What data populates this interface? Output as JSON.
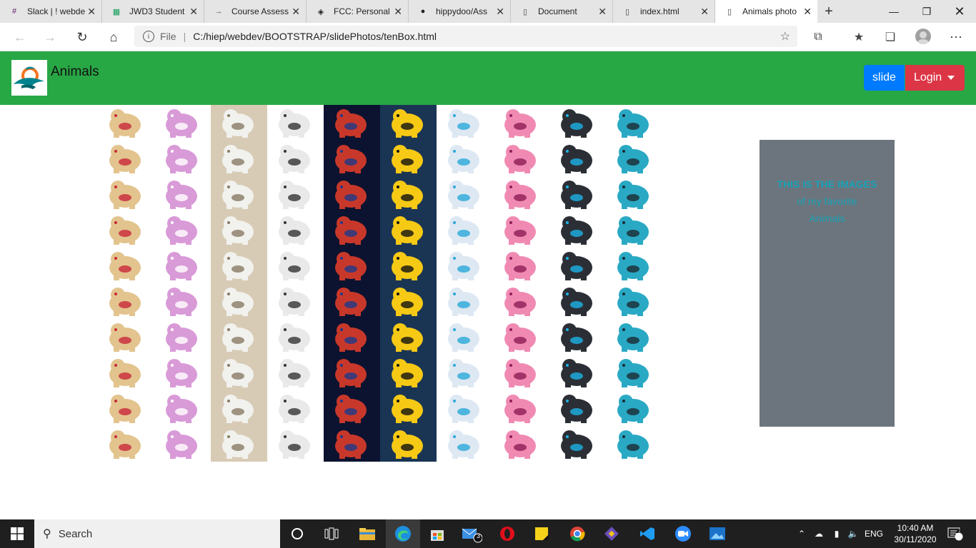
{
  "browser": {
    "tabs": [
      {
        "title": "Slack | ! webde",
        "icon": "slack-icon"
      },
      {
        "title": "JWD3 Student",
        "icon": "sheets-icon"
      },
      {
        "title": "Course Assess",
        "icon": "arrow-icon"
      },
      {
        "title": "FCC: Personal",
        "icon": "codepen-icon"
      },
      {
        "title": "hippydoo/Ass",
        "icon": "github-icon"
      },
      {
        "title": "Document",
        "icon": "page-icon"
      },
      {
        "title": "index.html",
        "icon": "page-icon"
      },
      {
        "title": "Animals photo",
        "icon": "page-icon",
        "active": true
      }
    ],
    "address": {
      "prefix": "File",
      "url": "C:/hiep/webdev/BOOTSTRAP/slidePhotos/tenBox.html"
    }
  },
  "page": {
    "brand": "Animals",
    "buttons": {
      "slide": "slide",
      "login": "Login"
    },
    "info": {
      "line1": "THIS IS THE IMAGES",
      "line2": "of my favorite",
      "line3": "Animals"
    },
    "colors": {
      "navbar": "#28a745",
      "primary": "#007bff",
      "danger": "#dc3545",
      "secondary": "#6c757d",
      "info": "#17a2b8"
    },
    "grid": {
      "rows": 10,
      "columns": [
        {
          "name": "golden-puppy-toy",
          "bg": "#ffffff",
          "body": "#e3c48e",
          "accent": "#c8283a"
        },
        {
          "name": "pink-unicorn-cat-toy",
          "bg": "#ffffff",
          "body": "#d99ad8",
          "accent": "#ffffff"
        },
        {
          "name": "marscat-robot-cat",
          "bg": "#d8cbb5",
          "body": "#f1f1ee",
          "accent": "#8a7b64"
        },
        {
          "name": "white-robot-dog",
          "bg": "#ffffff",
          "body": "#e9e9e9",
          "accent": "#333333"
        },
        {
          "name": "red-robot-dog-stage",
          "bg": "#0b1330",
          "body": "#c8382a",
          "accent": "#1e3a8a"
        },
        {
          "name": "spot-yellow-robot",
          "bg": "#1a3554",
          "body": "#f6c915",
          "accent": "#111111"
        },
        {
          "name": "blue-robot-cat",
          "bg": "#ffffff",
          "body": "#dde8f3",
          "accent": "#2ba7d8"
        },
        {
          "name": "pink-robot-cat",
          "bg": "#ffffff",
          "body": "#f08ab3",
          "accent": "#8f1d56"
        },
        {
          "name": "black-robot-puppy",
          "bg": "#ffffff",
          "body": "#2b2f35",
          "accent": "#1bb3e6"
        },
        {
          "name": "cyan-robot-dog",
          "bg": "#ffffff",
          "body": "#2aa9c4",
          "accent": "#1c2a33"
        }
      ]
    }
  },
  "taskbar": {
    "search_placeholder": "Search",
    "mail_badge": "3",
    "lang": "ENG",
    "time": "10:40 AM",
    "date": "30/11/2020",
    "notifications": "18"
  }
}
